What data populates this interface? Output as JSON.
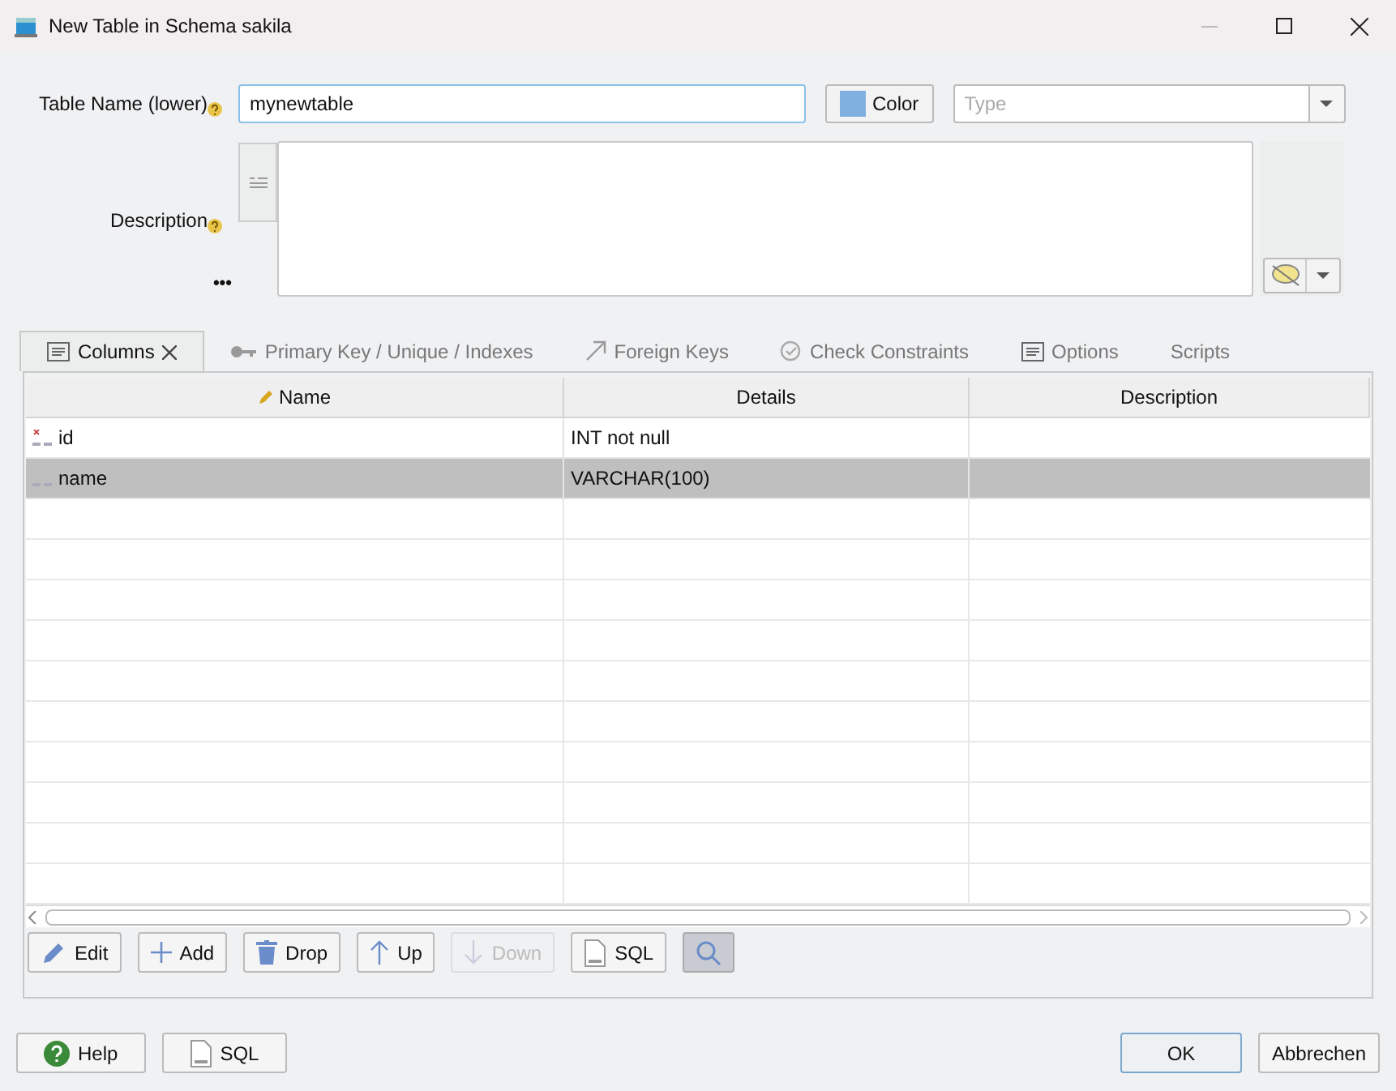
{
  "window": {
    "title": "New Table in Schema sakila"
  },
  "table_name": {
    "label": "Table Name (lower)",
    "value": "mynewtable"
  },
  "color_button": {
    "label": "Color",
    "color": "#7fb0e0"
  },
  "type_field": {
    "placeholder": "Type"
  },
  "description": {
    "label": "Description",
    "more": "•••"
  },
  "tabs": [
    {
      "label": "Columns",
      "selected": true
    },
    {
      "label": "Primary Key / Unique / Indexes",
      "selected": false
    },
    {
      "label": "Foreign Keys",
      "selected": false
    },
    {
      "label": "Check Constraints",
      "selected": false
    },
    {
      "label": "Options",
      "selected": false
    },
    {
      "label": "Scripts",
      "selected": false
    }
  ],
  "table": {
    "columns": [
      "Name",
      "Details",
      "Description"
    ],
    "rows": [
      {
        "name": "id",
        "details": "INT not null",
        "not_null": true,
        "selected": false
      },
      {
        "name": "name",
        "details": "VARCHAR(100)",
        "not_null": false,
        "selected": true
      }
    ]
  },
  "toolbar": [
    {
      "label": "Edit",
      "disabled": false
    },
    {
      "label": "Add",
      "disabled": false
    },
    {
      "label": "Drop",
      "disabled": false
    },
    {
      "label": "Up",
      "disabled": false
    },
    {
      "label": "Down",
      "disabled": true
    },
    {
      "label": "SQL",
      "disabled": false
    }
  ],
  "search_toggle": {
    "pressed": true
  },
  "footer": {
    "left": [
      {
        "label": "Help"
      },
      {
        "label": "SQL"
      }
    ],
    "right": [
      {
        "label": "OK",
        "default": true
      },
      {
        "label": "Abbrechen",
        "default": false
      }
    ]
  }
}
